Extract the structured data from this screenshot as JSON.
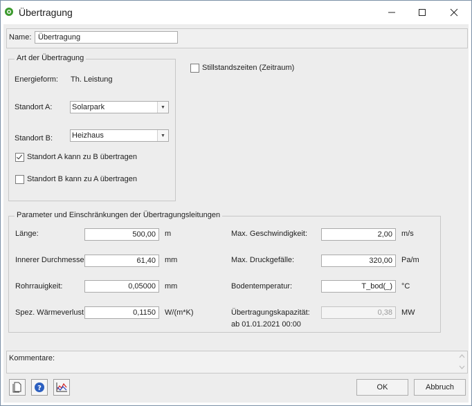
{
  "window": {
    "title": "Übertragung",
    "min": "—",
    "max": "☐",
    "close": "✕"
  },
  "name": {
    "label": "Name:",
    "value": "Übertragung"
  },
  "art": {
    "title": "Art der Übertragung",
    "energieform_label": "Energieform:",
    "energieform_value": "Th. Leistung",
    "standort_a_label": "Standort A:",
    "standort_a_value": "Solarpark",
    "standort_b_label": "Standort B:",
    "standort_b_value": "Heizhaus",
    "a_to_b_label": "Standort A kann zu B übertragen",
    "a_to_b_checked": true,
    "b_to_a_label": "Standort B kann zu A übertragen",
    "b_to_a_checked": false
  },
  "still": {
    "label": "Stillstandszeiten (Zeitraum)",
    "checked": false
  },
  "params": {
    "title": "Parameter und Einschränkungen der Übertragungsleitungen",
    "laenge": {
      "label": "Länge:",
      "value": "500,00",
      "unit": "m"
    },
    "durchmesser": {
      "label": "Innerer Durchmesser:",
      "value": "61,40",
      "unit": "mm"
    },
    "rauigkeit": {
      "label": "Rohrrauigkeit:",
      "value": "0,05000",
      "unit": "mm"
    },
    "waermeverlust": {
      "label": "Spez. Wärmeverlust:",
      "value": "0,1150",
      "unit": "W/(m*K)"
    },
    "geschwindigkeit": {
      "label": "Max. Geschwindigkeit:",
      "value": "2,00",
      "unit": "m/s"
    },
    "druckgefaelle": {
      "label": "Max. Druckgefälle:",
      "value": "320,00",
      "unit": "Pa/m"
    },
    "bodentemperatur": {
      "label": "Bodentemperatur:",
      "value": "T_bod(_)",
      "unit": "°C"
    },
    "kapazitaet": {
      "label": "Übertragungskapazität:",
      "sublabel": "ab 01.01.2021 00:00",
      "value": "0,38",
      "unit": "MW"
    }
  },
  "comments": {
    "label": "Kommentare:"
  },
  "buttons": {
    "ok": "OK",
    "cancel": "Abbruch"
  },
  "toolbar": {
    "icons": [
      "document-icon",
      "help-icon",
      "chart-icon"
    ]
  }
}
